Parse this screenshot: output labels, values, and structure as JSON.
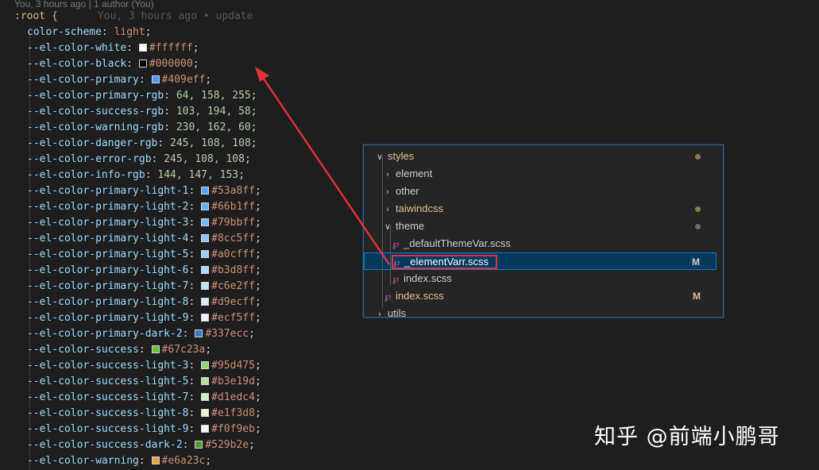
{
  "blame": {
    "top_line": "You, 3 hours ago | 1 author (You)",
    "inline": "You, 3 hours ago • update"
  },
  "editor": {
    "selector": ":root {",
    "lines": [
      {
        "prop": "color-scheme",
        "kind": "kw",
        "value": "light"
      },
      {
        "prop": "--el-color-white",
        "kind": "color",
        "color": "#ffffff",
        "value": "#ffffff"
      },
      {
        "prop": "--el-color-black",
        "kind": "color",
        "color": "#000000",
        "value": "#000000"
      },
      {
        "prop": "--el-color-primary",
        "kind": "color",
        "color": "#409eff",
        "value": "#409eff"
      },
      {
        "prop": "--el-color-primary-rgb",
        "kind": "rgb",
        "value": "64, 158, 255"
      },
      {
        "prop": "--el-color-success-rgb",
        "kind": "rgb",
        "value": "103, 194, 58"
      },
      {
        "prop": "--el-color-warning-rgb",
        "kind": "rgb",
        "value": "230, 162, 60"
      },
      {
        "prop": "--el-color-danger-rgb",
        "kind": "rgb",
        "value": "245, 108, 108"
      },
      {
        "prop": "--el-color-error-rgb",
        "kind": "rgb",
        "value": "245, 108, 108"
      },
      {
        "prop": "--el-color-info-rgb",
        "kind": "rgb",
        "value": "144, 147, 153"
      },
      {
        "prop": "--el-color-primary-light-1",
        "kind": "color",
        "color": "#53a8ff",
        "value": "#53a8ff"
      },
      {
        "prop": "--el-color-primary-light-2",
        "kind": "color",
        "color": "#66b1ff",
        "value": "#66b1ff"
      },
      {
        "prop": "--el-color-primary-light-3",
        "kind": "color",
        "color": "#79bbff",
        "value": "#79bbff"
      },
      {
        "prop": "--el-color-primary-light-4",
        "kind": "color",
        "color": "#8cc5ff",
        "value": "#8cc5ff"
      },
      {
        "prop": "--el-color-primary-light-5",
        "kind": "color",
        "color": "#a0cfff",
        "value": "#a0cfff"
      },
      {
        "prop": "--el-color-primary-light-6",
        "kind": "color",
        "color": "#b3d8ff",
        "value": "#b3d8ff"
      },
      {
        "prop": "--el-color-primary-light-7",
        "kind": "color",
        "color": "#c6e2ff",
        "value": "#c6e2ff"
      },
      {
        "prop": "--el-color-primary-light-8",
        "kind": "color",
        "color": "#d9ecff",
        "value": "#d9ecff"
      },
      {
        "prop": "--el-color-primary-light-9",
        "kind": "color",
        "color": "#ecf5ff",
        "value": "#ecf5ff"
      },
      {
        "prop": "--el-color-primary-dark-2",
        "kind": "color",
        "color": "#337ecc",
        "value": "#337ecc"
      },
      {
        "prop": "--el-color-success",
        "kind": "color",
        "color": "#67c23a",
        "value": "#67c23a"
      },
      {
        "prop": "--el-color-success-light-3",
        "kind": "color",
        "color": "#95d475",
        "value": "#95d475"
      },
      {
        "prop": "--el-color-success-light-5",
        "kind": "color",
        "color": "#b3e19d",
        "value": "#b3e19d"
      },
      {
        "prop": "--el-color-success-light-7",
        "kind": "color",
        "color": "#d1edc4",
        "value": "#d1edc4"
      },
      {
        "prop": "--el-color-success-light-8",
        "kind": "color",
        "color": "#e1f3d8",
        "value": "#e1f3d8"
      },
      {
        "prop": "--el-color-success-light-9",
        "kind": "color",
        "color": "#f0f9eb",
        "value": "#f0f9eb"
      },
      {
        "prop": "--el-color-success-dark-2",
        "kind": "color",
        "color": "#529b2e",
        "value": "#529b2e"
      },
      {
        "prop": "--el-color-warning",
        "kind": "color",
        "color": "#e6a23c",
        "value": "#e6a23c"
      }
    ]
  },
  "explorer": {
    "items": [
      {
        "label": "styles",
        "type": "folder-open",
        "color": "#e2c08d",
        "indicator": "dot",
        "indicator_color": "#8a7a4a"
      },
      {
        "label": "element",
        "type": "folder-closed",
        "color": "#cccccc"
      },
      {
        "label": "other",
        "type": "folder-closed",
        "color": "#cccccc"
      },
      {
        "label": "taiwindcss",
        "type": "folder-closed",
        "color": "#e2c08d",
        "indicator": "dot",
        "indicator_color": "#8a7a4a"
      },
      {
        "label": "theme",
        "type": "folder-open",
        "color": "#cccccc",
        "indicator": "dot",
        "indicator_color": "#6a6a6a"
      },
      {
        "label": "_defaultThemeVar.scss",
        "type": "file",
        "color": "#cccccc"
      },
      {
        "label": "_elementVarr.scss",
        "type": "file",
        "color": "#ffffff",
        "selected": true,
        "badge": "M",
        "badge_color": "#cccccc"
      },
      {
        "label": "index.scss",
        "type": "file",
        "color": "#cccccc"
      },
      {
        "label": "index.scss",
        "type": "file",
        "color": "#e2c08d",
        "badge": "M",
        "badge_color": "#e2c08d"
      },
      {
        "label": "utils",
        "type": "folder-closed",
        "color": "#cccccc"
      }
    ]
  },
  "watermark": {
    "text": "知乎 @前端小鹏哥"
  },
  "colors": {
    "annotation_red": "#e0313b",
    "sass_pink": "#cd6799",
    "selection_bg": "#04395e",
    "selection_border": "#007fd4"
  }
}
